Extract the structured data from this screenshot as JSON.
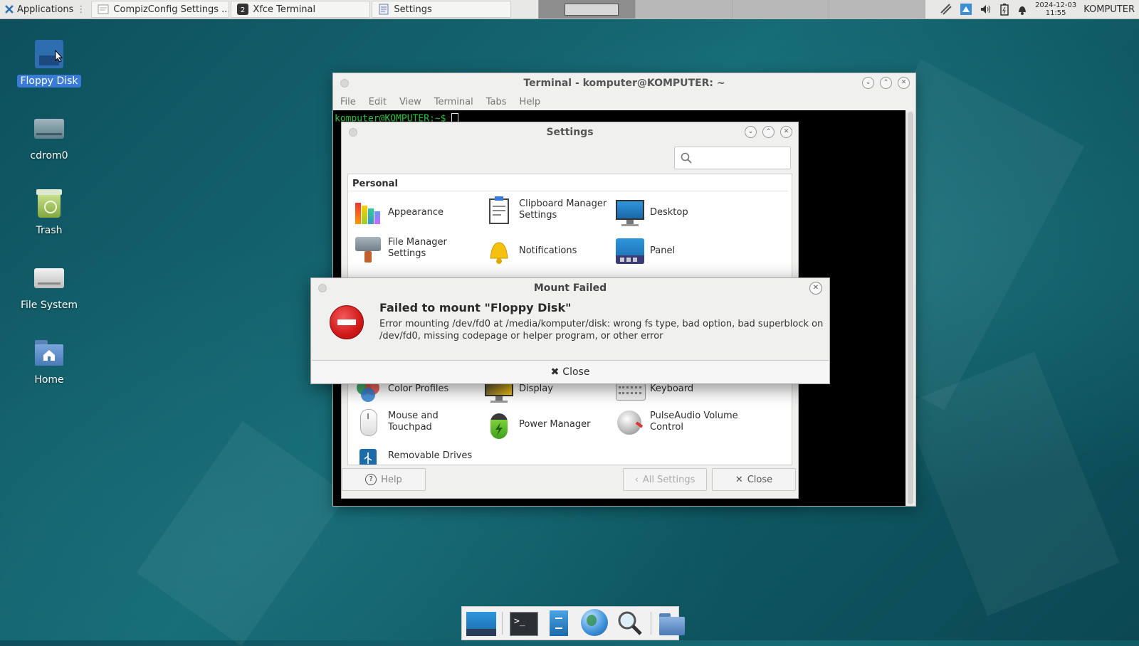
{
  "top_panel": {
    "applications_label": "Applications",
    "tasks": [
      {
        "label": "CompizConfig Settings ...",
        "icon": "compizconfig-icon"
      },
      {
        "label": "Xfce Terminal",
        "icon": "terminal-icon"
      },
      {
        "label": "Settings",
        "icon": "settings-icon"
      }
    ],
    "clock_date": "2024-12-03",
    "clock_time": "11:55",
    "hostname": "KOMPUTER"
  },
  "desktop_icons": [
    {
      "label": "Floppy Disk",
      "icon": "floppy-disk-icon",
      "selected": true
    },
    {
      "label": "cdrom0",
      "icon": "cdrom-icon"
    },
    {
      "label": "Trash",
      "icon": "trash-icon"
    },
    {
      "label": "File System",
      "icon": "drive-icon"
    },
    {
      "label": "Home",
      "icon": "home-folder-icon"
    }
  ],
  "terminal": {
    "title": "Terminal - komputer@KOMPUTER: ~",
    "menu": [
      "File",
      "Edit",
      "View",
      "Terminal",
      "Tabs",
      "Help"
    ],
    "prompt": "komputer@KOMPUTER:~$ "
  },
  "settings_window": {
    "title": "Settings",
    "search": {
      "value": "",
      "placeholder": ""
    },
    "section_personal": "Personal",
    "items": [
      {
        "label": "Appearance",
        "icon": "appearance-icon"
      },
      {
        "label": "Clipboard Manager Settings",
        "icon": "clipboard-icon"
      },
      {
        "label": "Desktop",
        "icon": "desktop-icon"
      },
      {
        "label": "File Manager Settings",
        "icon": "file-manager-icon"
      },
      {
        "label": "Notifications",
        "icon": "bell-icon"
      },
      {
        "label": "Panel",
        "icon": "panel-icon"
      },
      {
        "label": "Color Profiles",
        "icon": "color-profiles-icon"
      },
      {
        "label": "Display",
        "icon": "display-icon"
      },
      {
        "label": "Keyboard",
        "icon": "keyboard-icon"
      },
      {
        "label": "Mouse and Touchpad",
        "icon": "mouse-icon"
      },
      {
        "label": "Power Manager",
        "icon": "battery-icon"
      },
      {
        "label": "PulseAudio Volume Control",
        "icon": "volume-knob-icon"
      },
      {
        "label": "Removable Drives",
        "icon": "usb-icon"
      }
    ],
    "help_label": "Help",
    "all_settings_label": "All Settings",
    "close_label": "Close"
  },
  "dialog": {
    "title": "Mount Failed",
    "heading": "Failed to mount \"Floppy Disk\"",
    "message": "Error mounting /dev/fd0 at /media/komputer/disk: wrong fs type, bad option, bad superblock on /dev/fd0, missing codepage or helper program, or other error",
    "close_label": "Close"
  },
  "dock": {
    "items": [
      "show-desktop-icon",
      "terminal-icon",
      "file-manager-icon",
      "web-browser-icon",
      "search-icon",
      "folder-icon"
    ]
  },
  "colors": {
    "desktop_bg": "#166b76",
    "error_red": "#d01919",
    "terminal_prompt": "#2ecc40",
    "selection_blue": "#3a7bd5"
  }
}
